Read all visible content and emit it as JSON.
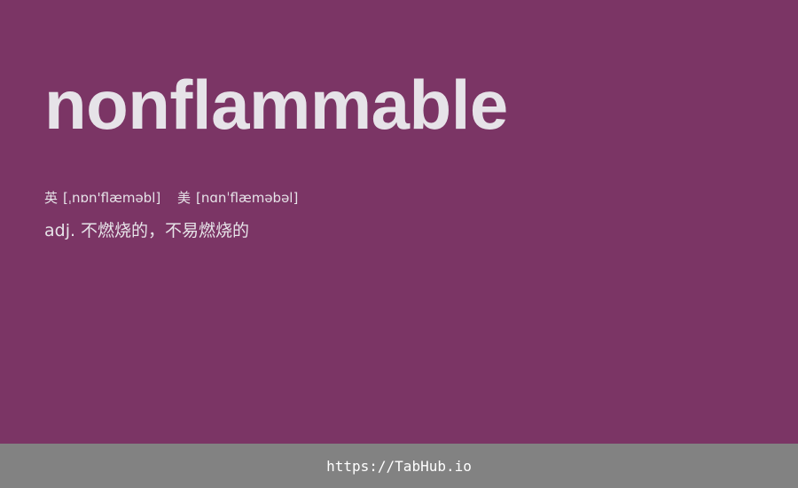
{
  "entry": {
    "word": "nonflammable",
    "pronunciations": [
      {
        "region": "英",
        "ipa": "[ˌnɒn'flæməbl]"
      },
      {
        "region": "美",
        "ipa": "[nɑnˈflæməbəl]"
      }
    ],
    "definition": {
      "pos": "adj.",
      "meaning": "不燃烧的，不易燃烧的"
    }
  },
  "footer": {
    "url": "https://TabHub.io"
  },
  "colors": {
    "background": "#7b3565",
    "footer_background": "#828282",
    "text": "#e6e3e8"
  }
}
